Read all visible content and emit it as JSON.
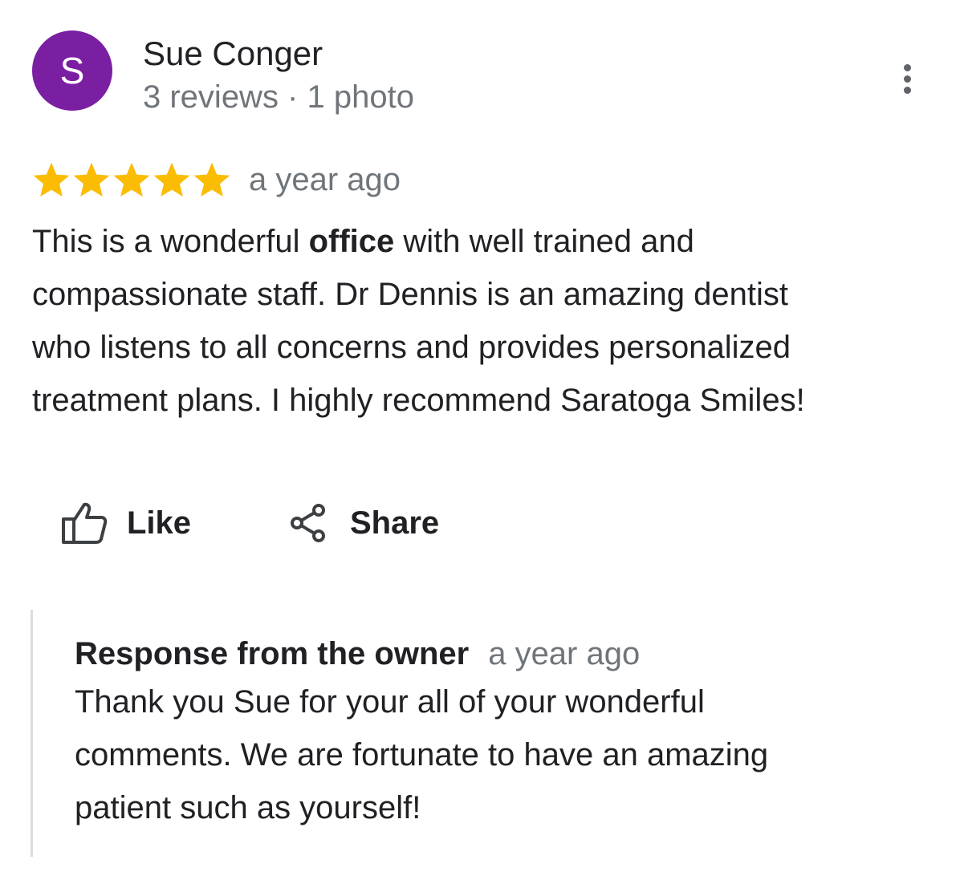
{
  "colors": {
    "avatar_bg": "#7b1fa2",
    "star": "#fbbc04",
    "primary_text": "#202124",
    "secondary_text": "#70757a",
    "icon": "#3c4043",
    "divider": "#dadce0"
  },
  "reviewer": {
    "avatar_initial": "S",
    "name": "Sue Conger",
    "meta": "3 reviews · 1 photo"
  },
  "menu": {
    "icon": "more-vert-icon"
  },
  "review": {
    "rating": 5,
    "max_rating": 5,
    "date": "a year ago",
    "text_before": "This is a wonderful ",
    "text_bold": "office",
    "text_after": " with well trained and\ncompassionate  staff. Dr Dennis is an amazing dentist\nwho listens to all concerns and provides personalized\ntreatment plans. I highly recommend Saratoga Smiles!"
  },
  "actions": {
    "like_label": "Like",
    "like_icon": "thumb-up-outline-icon",
    "share_label": "Share",
    "share_icon": "share-icon"
  },
  "owner_response": {
    "title": "Response from the owner",
    "date": "a year ago",
    "text": "Thank you Sue for your all of your wonderful\ncomments. We are fortunate to have an amazing\npatient such as  yourself!"
  }
}
